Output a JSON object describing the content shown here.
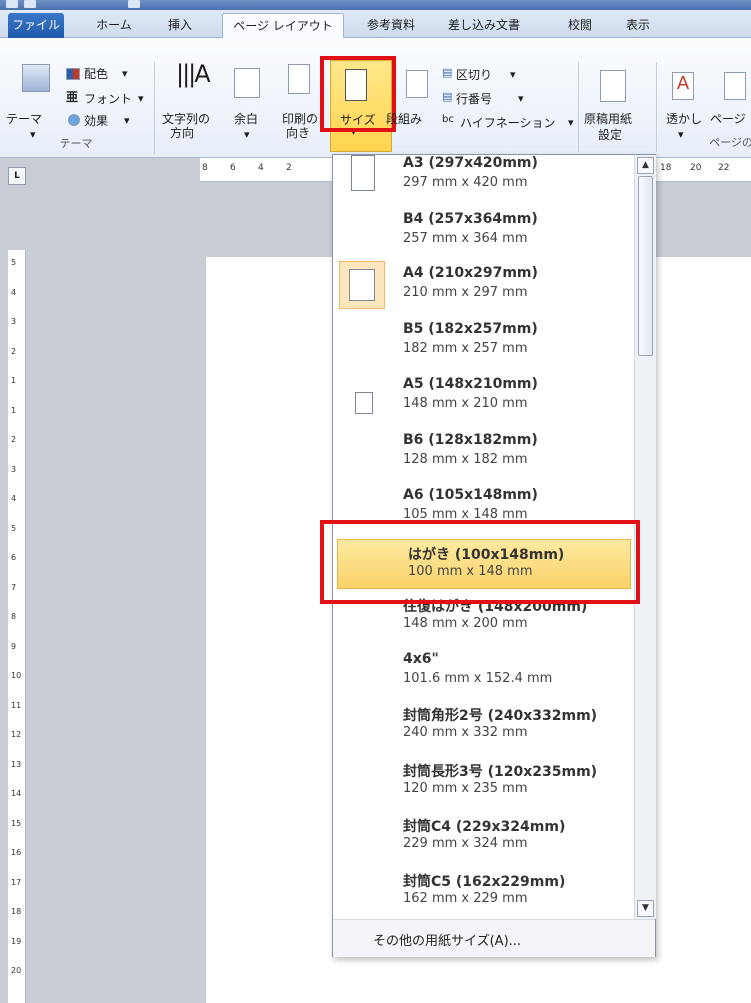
{
  "tabs": [
    {
      "label": "ファイル"
    },
    {
      "label": "ホーム"
    },
    {
      "label": "挿入"
    },
    {
      "label": "ページ レイアウト"
    },
    {
      "label": "参考資料"
    },
    {
      "label": "差し込み文書"
    },
    {
      "label": "校閲"
    },
    {
      "label": "表示"
    }
  ],
  "ribbon": {
    "theme_btn": "テーマ",
    "colors": "配色",
    "fonts": "フォント",
    "effects": "効果",
    "theme_group": "テーマ",
    "text_direction_1": "文字列の",
    "text_direction_2": "方向",
    "margins": "余白",
    "orientation_1": "印刷の",
    "orientation_2": "向き",
    "size": "サイズ",
    "columns": "段組み",
    "breaks": "区切り",
    "line_numbers": "行番号",
    "hyphenation": "ハイフネーション",
    "manuscript_1": "原稿用紙",
    "manuscript_2": "設定",
    "watermark": "透かし",
    "page_color": "ページ",
    "page_bg_group": "ページの"
  },
  "ruler_ticks": [
    "8",
    "6",
    "4",
    "2",
    "18",
    "20",
    "22"
  ],
  "vruler_ticks": [
    "5",
    "4",
    "3",
    "2",
    "1",
    "1",
    "2",
    "3",
    "4",
    "5",
    "6",
    "7",
    "8",
    "9",
    "10",
    "11",
    "12",
    "13",
    "14",
    "15",
    "16",
    "17",
    "18",
    "19",
    "20"
  ],
  "size_options": [
    {
      "name": "A3 (297x420mm)",
      "dim": "297 mm x 420 mm"
    },
    {
      "name": "B4 (257x364mm)",
      "dim": "257 mm x 364 mm"
    },
    {
      "name": "A4 (210x297mm)",
      "dim": "210 mm x 297 mm"
    },
    {
      "name": "B5 (182x257mm)",
      "dim": "182 mm x 257 mm"
    },
    {
      "name": "A5 (148x210mm)",
      "dim": "148 mm x 210 mm"
    },
    {
      "name": "B6 (128x182mm)",
      "dim": "128 mm x 182 mm"
    },
    {
      "name": "A6 (105x148mm)",
      "dim": "105 mm x 148 mm"
    },
    {
      "name": "はがき (100x148mm)",
      "dim": "100 mm x 148 mm"
    },
    {
      "name": "往復はがき (148x200mm)",
      "dim": "148 mm x 200 mm"
    },
    {
      "name": "4x6\"",
      "dim": "101.6 mm x 152.4 mm"
    },
    {
      "name": "封筒角形2号 (240x332mm)",
      "dim": "240 mm x 332 mm"
    },
    {
      "name": "封筒長形3号 (120x235mm)",
      "dim": "120 mm x 235 mm"
    },
    {
      "name": "封筒C4 (229x324mm)",
      "dim": "229 mm x 324 mm"
    },
    {
      "name": "封筒C5 (162x229mm)",
      "dim": "162 mm x 229 mm"
    }
  ],
  "more_sizes": "その他の用紙サイズ(A)..."
}
